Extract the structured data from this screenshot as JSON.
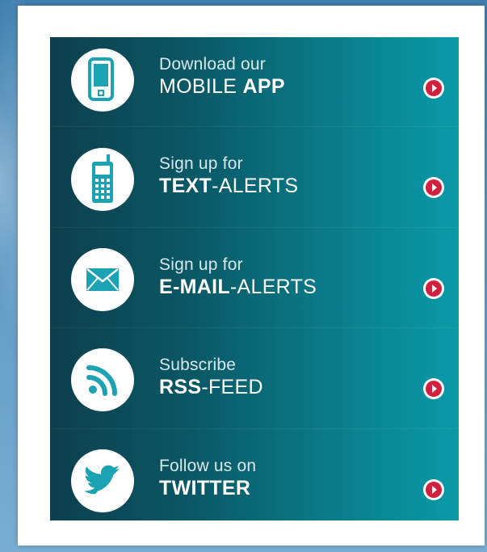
{
  "colors": {
    "accent_teal": "#1ba3b3",
    "arrow_red": "#d2203f",
    "panel_dark": "#0d3f4d",
    "panel_light": "#0a9aa8"
  },
  "items": [
    {
      "icon": "mobile-phone-icon",
      "line1": "Download our",
      "bold": "MOBILE",
      "rest_bold": "APP",
      "rest_light": ""
    },
    {
      "icon": "cellphone-icon",
      "line1": "Sign up for",
      "bold": "TEXT",
      "rest_bold": "",
      "rest_light": "-ALERTS"
    },
    {
      "icon": "envelope-icon",
      "line1": "Sign up for",
      "bold": "E-MAIL",
      "rest_bold": "",
      "rest_light": "-ALERTS"
    },
    {
      "icon": "rss-icon",
      "line1": "Subscribe",
      "bold": "RSS",
      "rest_bold": "",
      "rest_light": "-FEED"
    },
    {
      "icon": "twitter-bird-icon",
      "line1": "Follow us on",
      "bold": "TWITTER",
      "rest_bold": "",
      "rest_light": ""
    }
  ]
}
